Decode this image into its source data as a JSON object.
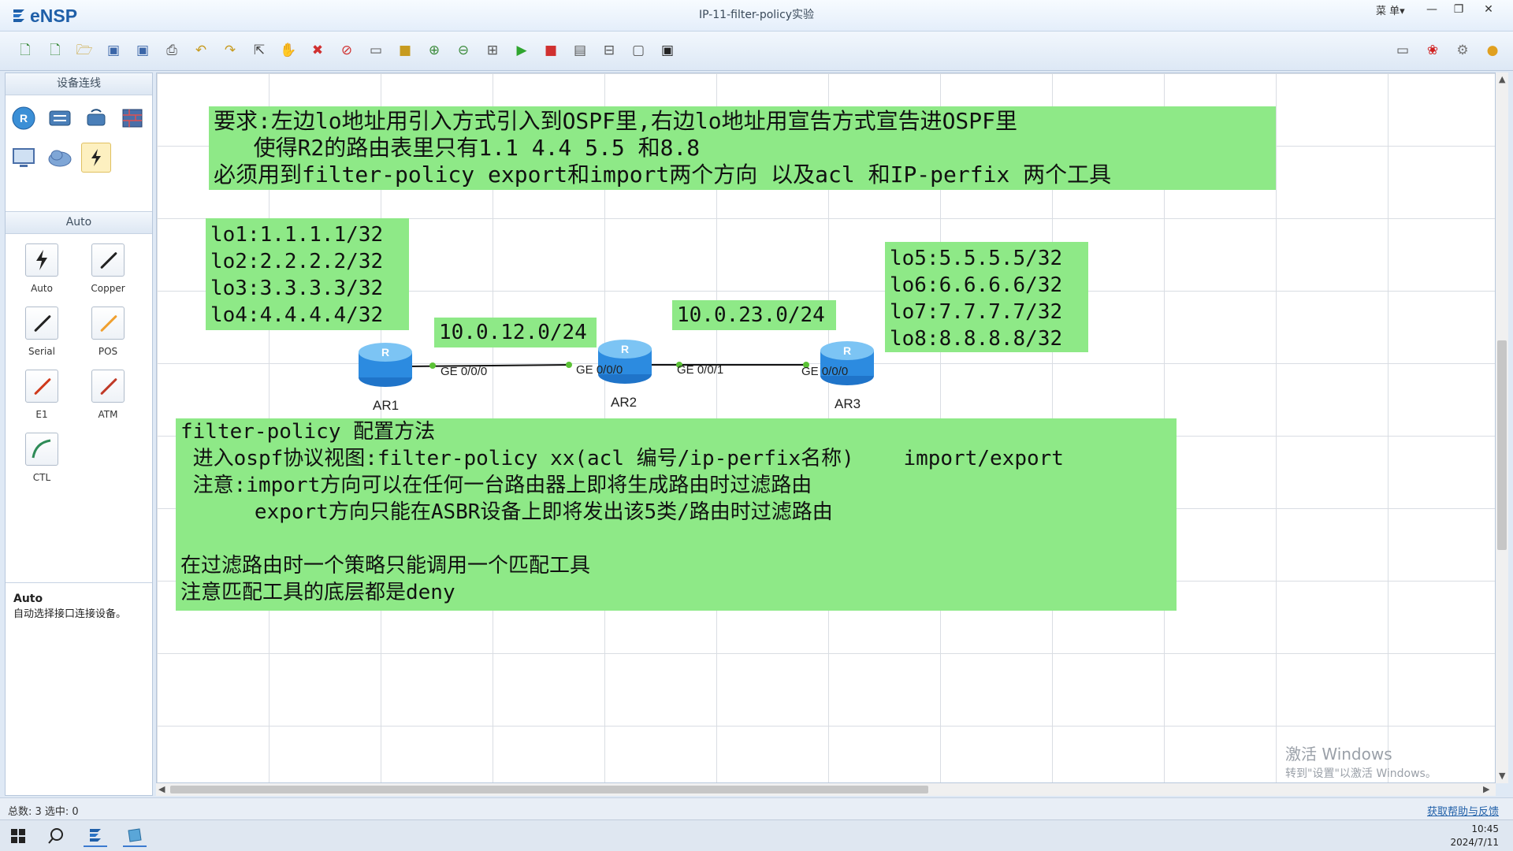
{
  "app": {
    "name": "eNSP",
    "window_title": "IP-11-filter-policy实验",
    "menu_label": "菜 单▾"
  },
  "window_buttons": {
    "minimize": "—",
    "restore": "❐",
    "close": "✕"
  },
  "left_panel": {
    "device_header": "设备连线",
    "cable_header": "Auto",
    "cables": [
      {
        "label": "Auto",
        "color": "#222222"
      },
      {
        "label": "Copper",
        "color": "#222222"
      },
      {
        "label": "Serial",
        "color": "#222222"
      },
      {
        "label": "POS",
        "color": "#f0a030"
      },
      {
        "label": "E1",
        "color": "#d03a1c"
      },
      {
        "label": "ATM",
        "color": "#c03a28"
      },
      {
        "label": "CTL",
        "color": "#2e8b57"
      }
    ],
    "description": {
      "title": "Auto",
      "text": "自动选择接口连接设备。"
    }
  },
  "canvas": {
    "notes": {
      "requirement": "要求:左边lo地址用引入方式引入到OSPF里,右边lo地址用宣告方式宣告进OSPF里\n   使得R2的路由表里只有1.1 4.4 5.5 和8.8\n必须用到filter-policy export和import两个方向 以及acl 和IP-perfix 两个工具",
      "left_loopbacks": "lo1:1.1.1.1/32\nlo2:2.2.2.2/32\nlo3:3.3.3.3/32\nlo4:4.4.4.4/32",
      "right_loopbacks": "lo5:5.5.5.5/32\nlo6:6.6.6.6/32\nlo7:7.7.7.7/32\nlo8:8.8.8.8/32",
      "net12": "10.0.12.0/24",
      "net23": "10.0.23.0/24",
      "method": "filter-policy 配置方法\n 进入ospf协议视图:filter-policy xx(acl 编号/ip-perfix名称)    import/export\n 注意:import方向可以在任何一台路由器上即将生成路由时过滤路由\n      export方向只能在ASBR设备上即将发出该5类/路由时过滤路由\n\n在过滤路由时一个策略只能调用一个匹配工具\n注意匹配工具的底层都是deny"
    },
    "routers": [
      {
        "label": "AR1"
      },
      {
        "label": "AR2"
      },
      {
        "label": "AR3"
      }
    ],
    "ports": {
      "ar1_g000": "GE 0/0/0",
      "ar2_g000": "GE 0/0/0",
      "ar2_g001": "GE 0/0/1",
      "ar3_g000": "GE 0/0/0"
    },
    "link_color": "#111111",
    "port_dot_color": "#5bc236",
    "watermark": {
      "line1": "激活 Windows",
      "line2": "转到\"设置\"以激活 Windows。"
    }
  },
  "statusbar": {
    "left": "总数: 3 选中: 0",
    "help": "获取帮助与反馈"
  },
  "taskbar": {
    "time": "10:45",
    "date": "2024/7/11"
  },
  "icons": {
    "toolbar": [
      "new-topo-icon",
      "new-icon",
      "open-icon",
      "save-icon",
      "save-as-icon",
      "print-icon",
      "undo-icon",
      "redo-icon",
      "select-icon",
      "pan-icon",
      "delete-icon",
      "delete-link-icon",
      "text-icon",
      "rectangle-icon",
      "zoom-in-icon",
      "zoom-out-icon",
      "fit-icon",
      "start-icon",
      "stop-icon",
      "capture-icon",
      "topo-icon",
      "grid-icon",
      "screenshot-icon"
    ],
    "right_toolbar": [
      "chat-icon",
      "huawei-icon",
      "settings-icon",
      "help-icon"
    ]
  }
}
